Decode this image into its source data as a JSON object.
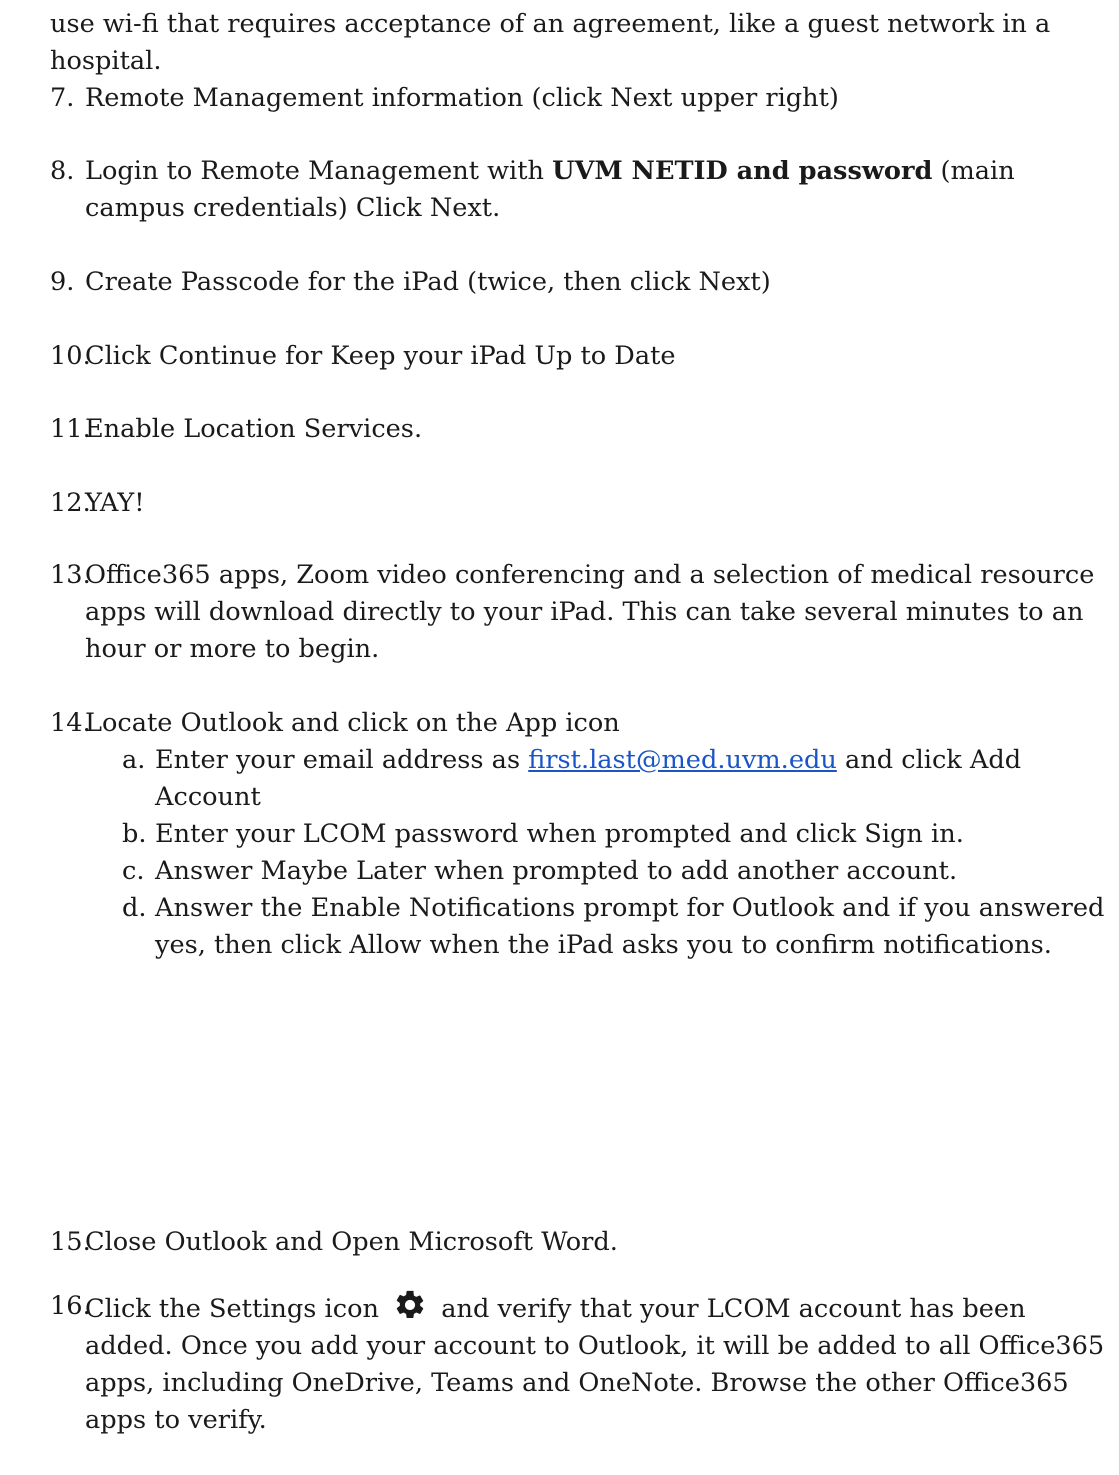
{
  "intro": "use wi-fi that requires acceptance of an agreement, like a guest network in a hospital.",
  "steps": [
    {
      "num": "7.",
      "text": "Remote Management information (click Next upper right)"
    },
    {
      "num": "8.",
      "pre": "Login to Remote Management with ",
      "bold": "UVM NETID and password",
      "post": " (main campus credentials) Click Next."
    },
    {
      "num": "9.",
      "text": "Create Passcode for the iPad (twice, then click Next)"
    },
    {
      "num": "10.",
      "text": "Click Continue for Keep your iPad Up to Date"
    },
    {
      "num": "11.",
      "text": "Enable Location Services."
    },
    {
      "num": "12.",
      "text": "YAY!"
    },
    {
      "num": "13.",
      "text": "Office365 apps, Zoom video conferencing and a selection of medical resource apps will download directly to your iPad. This can take several minutes to an hour or more to begin."
    },
    {
      "num": "14.",
      "text": "Locate Outlook and click on the App icon",
      "sub": [
        {
          "letter": "a.",
          "pre": "Enter your email address as ",
          "link": "first.last@med.uvm.edu",
          "post": " and click Add Account"
        },
        {
          "letter": "b.",
          "text": "Enter your LCOM password when prompted and click Sign in."
        },
        {
          "letter": "c.",
          "text": "Answer Maybe Later when prompted to add another account."
        },
        {
          "letter": "d.",
          "text": "Answer the Enable Notifications prompt for Outlook and if you answered yes, then click Allow when the iPad asks you to confirm notifications."
        }
      ]
    },
    {
      "num": "15.",
      "text": "Close Outlook and Open Microsoft Word."
    },
    {
      "num": "16.",
      "pre": "Click the Settings icon ",
      "icon": "gear-icon",
      "post": " and verify that your LCOM account has been added. Once you add your account to Outlook, it will be added to all Office365 apps, including OneDrive, Teams and OneNote. Browse the other Office365 apps to verify."
    }
  ]
}
